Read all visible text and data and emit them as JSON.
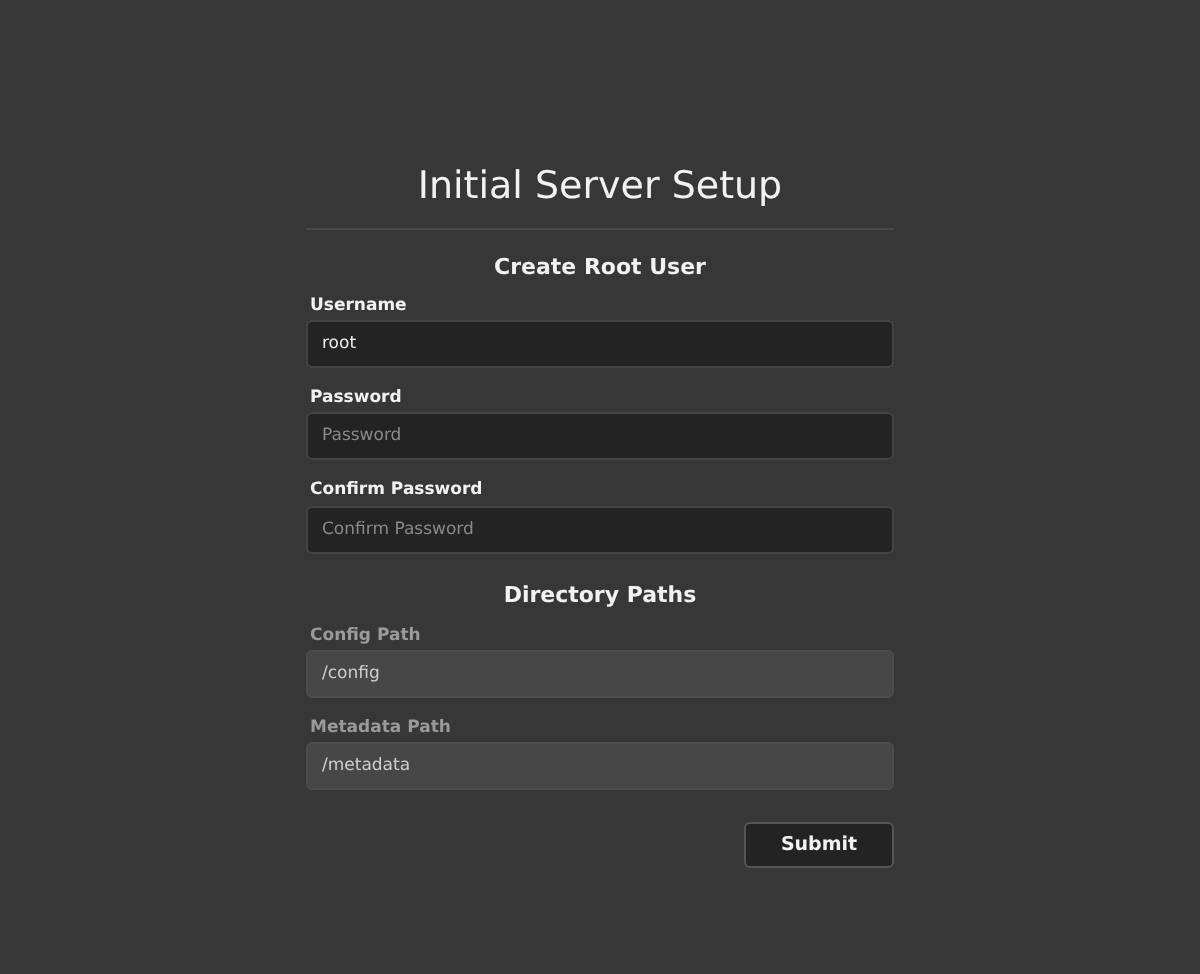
{
  "title": "Initial Server Setup",
  "sections": [
    {
      "heading": "Create Root User",
      "fields": [
        {
          "label": "Username",
          "value": "root",
          "disabled": false
        },
        {
          "label": "Password",
          "placeholder": "Password",
          "disabled": false
        },
        {
          "label": "Confirm Password",
          "placeholder": "Confirm Password",
          "disabled": false
        }
      ]
    },
    {
      "heading": "Directory Paths",
      "fields": [
        {
          "label": "Config Path",
          "value": "/config",
          "disabled": true
        },
        {
          "label": "Metadata Path",
          "value": "/metadata",
          "disabled": true
        }
      ]
    }
  ],
  "submit": "Submit"
}
